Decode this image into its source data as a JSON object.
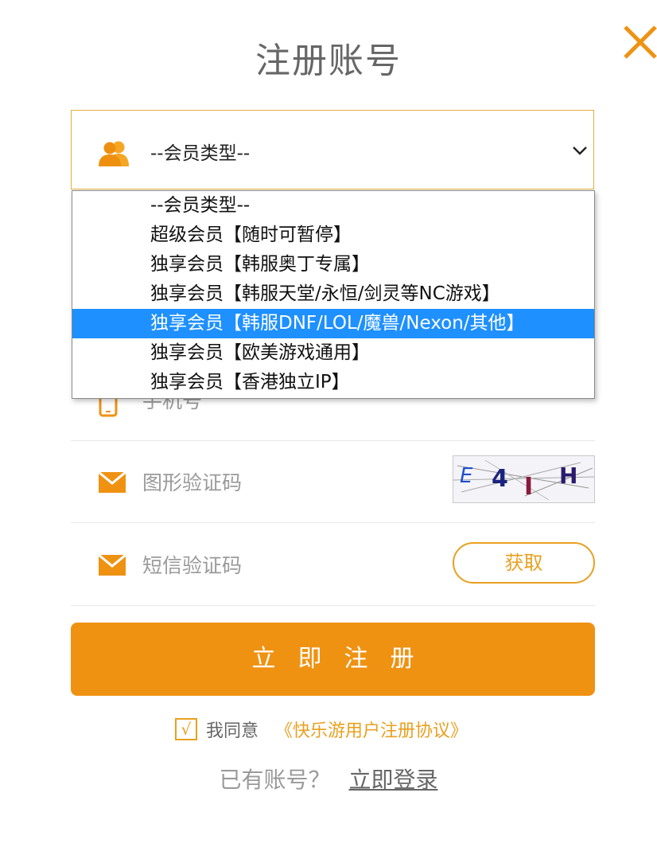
{
  "title": "注册账号",
  "member_select": {
    "value": "--会员类型--",
    "options": [
      "--会员类型--",
      "超级会员【随时可暂停】",
      "独享会员【韩服奥丁专属】",
      "独享会员【韩服天堂/永恒/剑灵等NC游戏】",
      "独享会员【韩服DNF/LOL/魔兽/Nexon/其他】",
      "独享会员【欧美游戏通用】",
      "独享会员【香港独立IP】"
    ],
    "highlighted_index": 4
  },
  "phone": {
    "placeholder": "手机号"
  },
  "captcha": {
    "placeholder": "图形验证码",
    "chars": [
      "E",
      "4",
      "I",
      "H"
    ]
  },
  "sms": {
    "placeholder": "短信验证码",
    "button": "获取"
  },
  "submit": "立即注册",
  "agreement": {
    "check": "√",
    "text": "我同意",
    "link": "《快乐游用户注册协议》"
  },
  "login": {
    "prompt": "已有账号？",
    "link": "立即登录"
  },
  "colors": {
    "accent": "#ef9212",
    "highlight": "#1e90ff",
    "border": "#e0b040"
  }
}
